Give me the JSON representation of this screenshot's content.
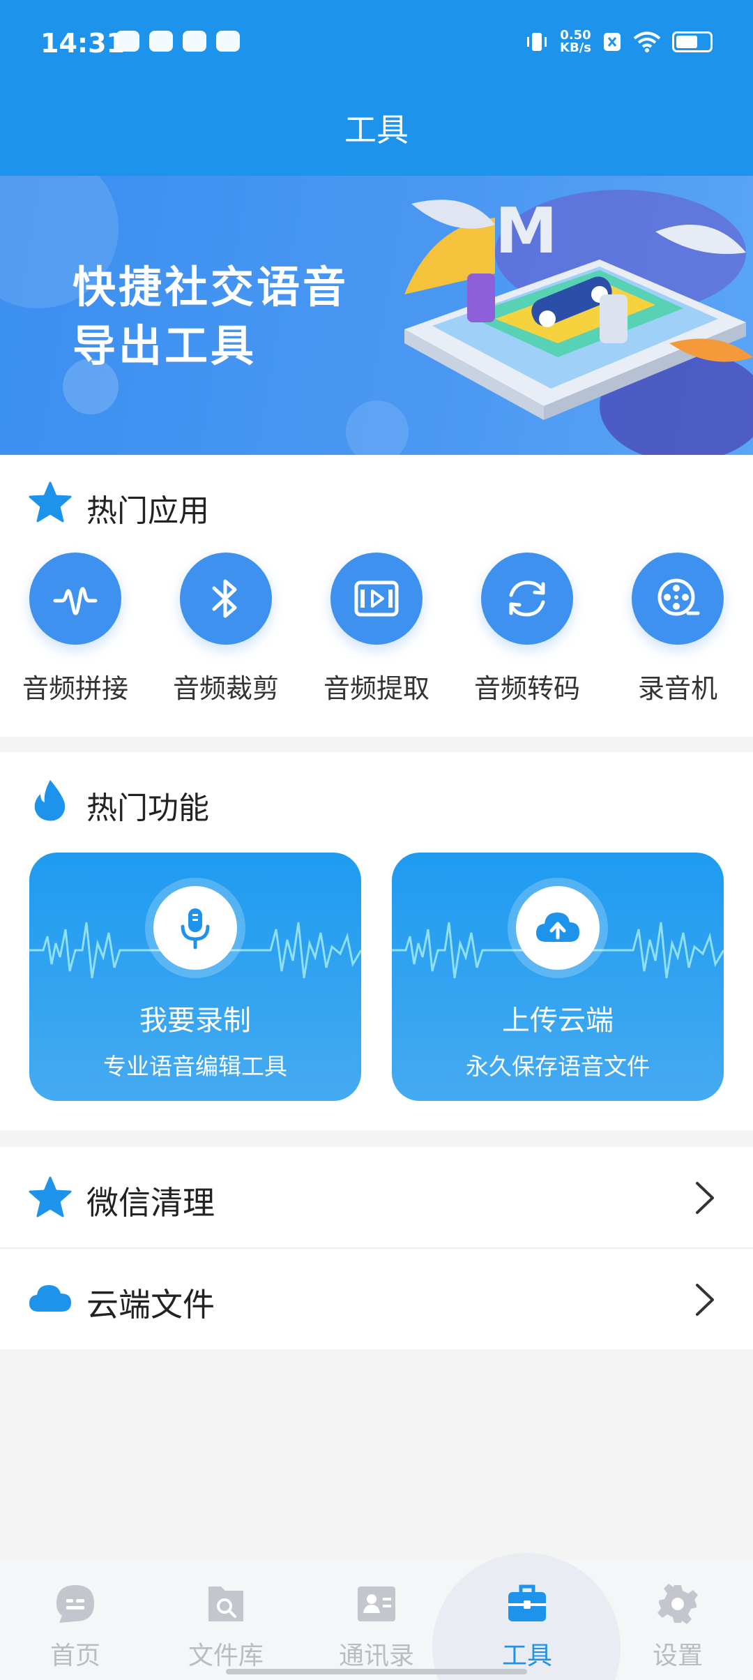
{
  "status_bar": {
    "time": "14:31",
    "net_speed_value": "0.50",
    "net_speed_unit": "KB/s"
  },
  "header": {
    "title": "工具"
  },
  "banner": {
    "line1": "快捷社交语音",
    "line2": "导出工具"
  },
  "hot_apps": {
    "title": "热门应用",
    "icon": "star-icon",
    "items": [
      {
        "label": "音频拼接",
        "icon": "waveform-icon"
      },
      {
        "label": "音频裁剪",
        "icon": "bluetooth-cut-icon"
      },
      {
        "label": "音频提取",
        "icon": "video-play-icon"
      },
      {
        "label": "音频转码",
        "icon": "refresh-icon"
      },
      {
        "label": "录音机",
        "icon": "film-reel-icon"
      }
    ]
  },
  "hot_features": {
    "title": "热门功能",
    "icon": "flame-icon",
    "cards": [
      {
        "title": "我要录制",
        "subtitle": "专业语音编辑工具",
        "icon": "microphone-icon"
      },
      {
        "title": "上传云端",
        "subtitle": "永久保存语音文件",
        "icon": "cloud-upload-icon"
      }
    ]
  },
  "list_rows": [
    {
      "label": "微信清理",
      "icon": "star-icon"
    },
    {
      "label": "云端文件",
      "icon": "cloud-icon"
    }
  ],
  "bottom_nav": {
    "items": [
      {
        "label": "首页",
        "icon": "chat-icon"
      },
      {
        "label": "文件库",
        "icon": "folder-search-icon"
      },
      {
        "label": "通讯录",
        "icon": "contact-card-icon"
      },
      {
        "label": "工具",
        "icon": "toolbox-icon",
        "active": true
      },
      {
        "label": "设置",
        "icon": "gear-icon"
      }
    ]
  },
  "colors": {
    "primary": "#1e93ec",
    "app_circle": "#3e91ee",
    "inactive_nav": "#b9bcc2"
  }
}
